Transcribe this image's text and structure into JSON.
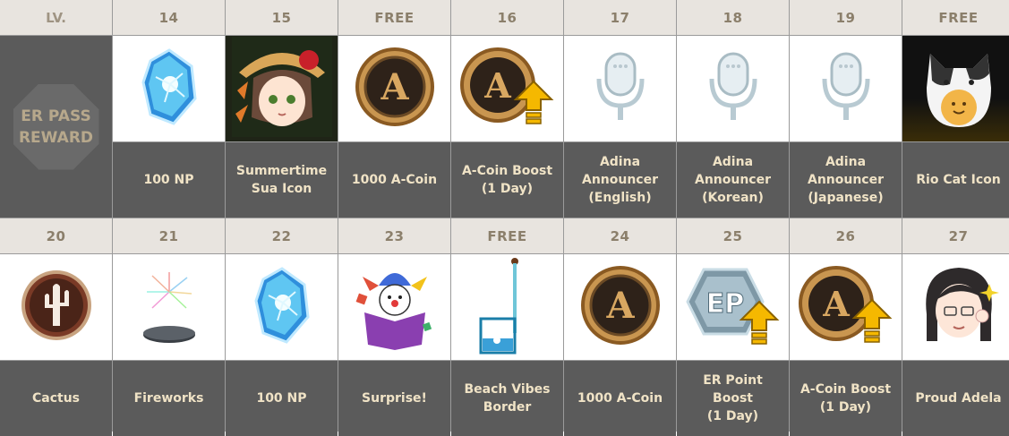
{
  "lv_header": "LV.",
  "side_label": "ER PASS\nREWARD",
  "row1": [
    {
      "level": "14",
      "name": "100 NP",
      "icon": "np-crystal-icon"
    },
    {
      "level": "15",
      "name": "Summertime\nSua Icon",
      "icon": "sua-portrait-icon"
    },
    {
      "level": "FREE",
      "name": "1000 A-Coin",
      "icon": "a-coin-icon"
    },
    {
      "level": "16",
      "name": "A-Coin Boost\n(1 Day)",
      "icon": "a-coin-boost-icon"
    },
    {
      "level": "17",
      "name": "Adina\nAnnouncer\n(English)",
      "icon": "microphone-icon"
    },
    {
      "level": "18",
      "name": "Adina\nAnnouncer\n(Korean)",
      "icon": "microphone-icon"
    },
    {
      "level": "19",
      "name": "Adina\nAnnouncer\n(Japanese)",
      "icon": "microphone-icon"
    },
    {
      "level": "FREE",
      "name": "Rio Cat Icon",
      "icon": "rio-cat-icon"
    }
  ],
  "row2": [
    {
      "level": "20",
      "name": "Cactus",
      "icon": "cactus-emblem-icon"
    },
    {
      "level": "21",
      "name": "Fireworks",
      "icon": "fireworks-icon"
    },
    {
      "level": "22",
      "name": "100 NP",
      "icon": "np-crystal-icon"
    },
    {
      "level": "23",
      "name": "Surprise!",
      "icon": "jester-box-icon"
    },
    {
      "level": "FREE",
      "name": "Beach Vibes\nBorder",
      "icon": "beach-border-icon"
    },
    {
      "level": "24",
      "name": "1000 A-Coin",
      "icon": "a-coin-icon"
    },
    {
      "level": "25",
      "name": "ER Point Boost\n(1 Day)",
      "icon": "ep-boost-icon"
    },
    {
      "level": "26",
      "name": "A-Coin Boost\n(1 Day)",
      "icon": "a-coin-boost-icon"
    },
    {
      "level": "27",
      "name": "Proud Adela",
      "icon": "adela-portrait-icon"
    }
  ],
  "coin_letter": "A",
  "ep_letters": "EP"
}
